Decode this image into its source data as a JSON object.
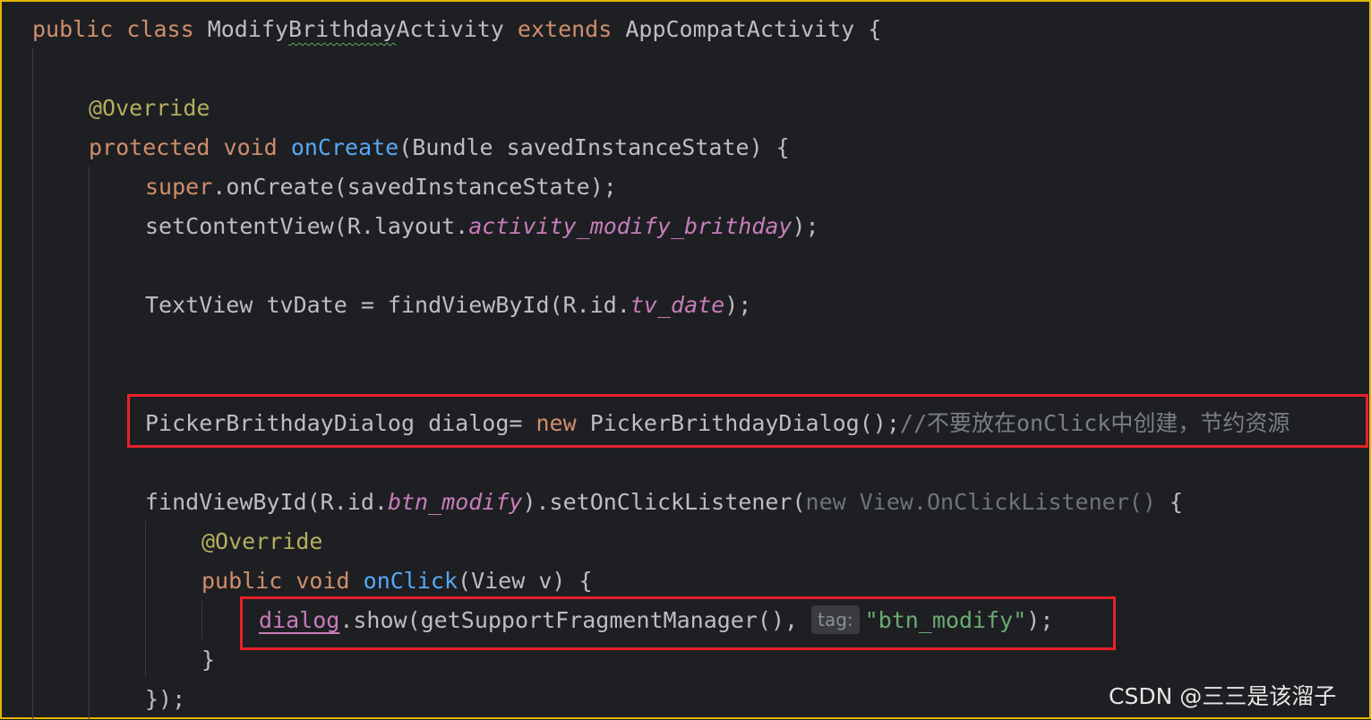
{
  "code": {
    "class_decl": {
      "kw1": "public",
      "kw2": "class",
      "name_a": "Modify",
      "name_b": "Brithday",
      "name_c": "Activity",
      "kw3": "extends",
      "superclass": "AppCompatActivity",
      "brace": "{"
    },
    "override1": "@Override",
    "oncreate_decl": {
      "kw1": "protected",
      "kw2": "void",
      "method": "onCreate",
      "params": "(Bundle savedInstanceState) {"
    },
    "super_call": {
      "kw": "super",
      "rest": ".onCreate(savedInstanceState);"
    },
    "set_content": {
      "pre": "setContentView(R.layout.",
      "field": "activity_modify_brithday",
      "post": ");"
    },
    "tvdate": {
      "pre": "TextView tvDate = findViewById(R.id.",
      "field": "tv_date",
      "post": ");"
    },
    "dialog_line": {
      "pre": "PickerBrithdayDialog dialog= ",
      "kw": "new",
      "post": " PickerBrithdayDialog();",
      "comment": "//不要放在onClick中创建，节约资源"
    },
    "listener_line": {
      "pre": "findViewById(R.id.",
      "field": "btn_modify",
      "mid": ").setOnClickListener(",
      "dim": "new View.OnClickListener()",
      "post": " {"
    },
    "override2": "@Override",
    "onclick_decl": {
      "kw1": "public",
      "kw2": "void",
      "method": "onClick",
      "params": "(View v) {"
    },
    "show_line": {
      "var": "dialog",
      "pre": ".show(getSupportFragmentManager(), ",
      "hint": "tag:",
      "str": "\"btn_modify\"",
      "post": ");"
    },
    "close_inner": "}",
    "close_listener": "});"
  },
  "watermark": "CSDN @三三是该溜子",
  "colors": {
    "keyword": "#cf8e6d",
    "annotation": "#b3ae60",
    "method": "#56a8f5",
    "field": "#c77dbb",
    "string": "#6aab73",
    "comment": "#7a7e85",
    "highlight_box": "#e8212b",
    "editor_frame": "#e0b800",
    "background": "#1e1f22"
  }
}
